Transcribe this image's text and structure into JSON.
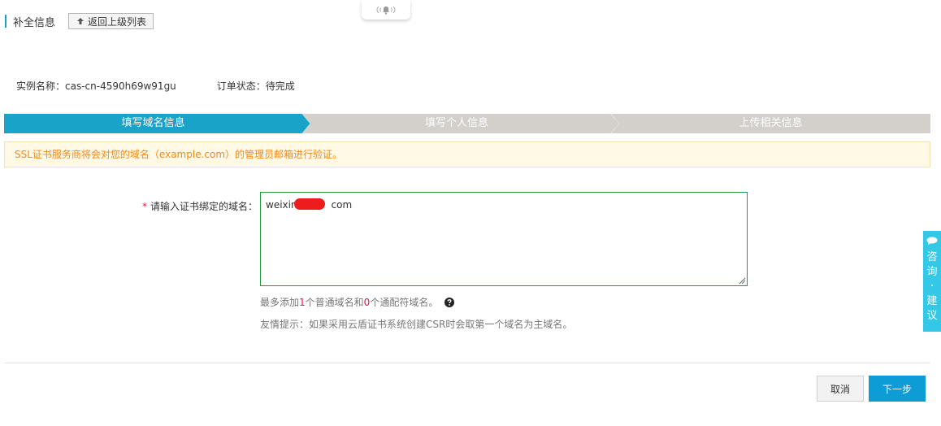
{
  "header": {
    "title": "补全信息",
    "back_label": "返回上级列表"
  },
  "meta": {
    "instance": "实例名称：cas-cn-4590h69w91gu",
    "order_status": "订单状态：待完成"
  },
  "steps": [
    {
      "label": "填写域名信息",
      "state": "active"
    },
    {
      "label": "填写个人信息",
      "state": "inactive"
    },
    {
      "label": "上传相关信息",
      "state": "inactive"
    }
  ],
  "notice": "SSL证书服务商将会对您的域名（example.com）的管理员邮箱进行验证。",
  "form": {
    "required_mark": "*",
    "label": "请输入证书绑定的域名：",
    "value": "weixin.          com"
  },
  "hints": {
    "prefix": "最多添加 ",
    "count_normal": "1",
    "mid": "个普通域名和 ",
    "count_wildcard": "0",
    "suffix": "个通配符域名。",
    "tip": "友情提示：如果采用云盾证书系统创建CSR时会取第一个域名为主域名。"
  },
  "buttons": {
    "cancel": "取消",
    "next": "下一步"
  },
  "consult": {
    "label": "咨询·建议"
  },
  "colors": {
    "accent": "#1aa3c8",
    "step_active": "#1aa3c8",
    "step_inactive": "#d3d0cb",
    "notice_text": "#f08a1c",
    "next_button": "#0c9dd6",
    "consult_tab": "#33c9e6"
  },
  "icons": {
    "notification": "broadcast-bell-icon",
    "back": "upload-arrow-icon",
    "help": "question-circle-icon",
    "consult": "chat-icon"
  }
}
